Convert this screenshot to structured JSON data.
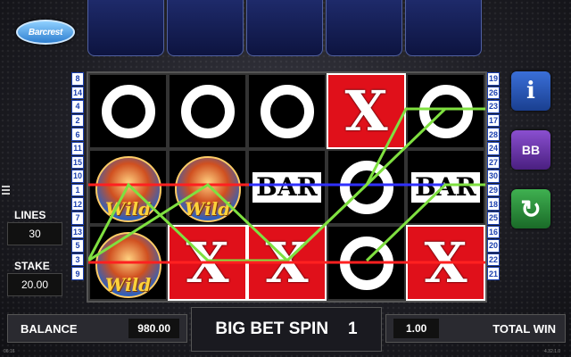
{
  "brand": {
    "logo_text": "Barcrest"
  },
  "paylines": {
    "left": [
      "8",
      "14",
      "4",
      "2",
      "6",
      "11",
      "15",
      "10",
      "1",
      "12",
      "7",
      "13",
      "5",
      "3",
      "9"
    ],
    "right": [
      "19",
      "26",
      "23",
      "17",
      "28",
      "24",
      "27",
      "30",
      "29",
      "18",
      "25",
      "16",
      "20",
      "22",
      "21"
    ]
  },
  "reels": [
    [
      "ring",
      "wild",
      "wild"
    ],
    [
      "ring",
      "wild",
      "x"
    ],
    [
      "ring",
      "bar",
      "x"
    ],
    [
      "x",
      "ring",
      "ring"
    ],
    [
      "ring",
      "bar",
      "x"
    ]
  ],
  "symbols": {
    "x_text": "X",
    "bar_text": "BAR",
    "wild_text": "Wild"
  },
  "side_buttons": [
    {
      "name": "info-icon",
      "glyph": "i",
      "color": "#1e4fb0"
    },
    {
      "name": "big-bet-icon",
      "glyph": "BB",
      "color": "#6a2fa0"
    },
    {
      "name": "replay-icon",
      "glyph": "↻",
      "color": "#1e8a2e"
    }
  ],
  "lines": {
    "label": "LINES",
    "value": "30"
  },
  "stake": {
    "label": "STAKE",
    "value": "20.00"
  },
  "balance": {
    "label": "BALANCE",
    "value": "980.00"
  },
  "spin": {
    "label": "BIG BET SPIN",
    "count": "1"
  },
  "total_win": {
    "label": "TOTAL WIN",
    "value": "1.00"
  },
  "footer": {
    "time": "06:16",
    "version": "4.32.1.0"
  },
  "colors": {
    "red": "#e0101a",
    "payline_green": "#7fe040",
    "payline_red": "#ff2020",
    "payline_blue": "#3030ff"
  }
}
